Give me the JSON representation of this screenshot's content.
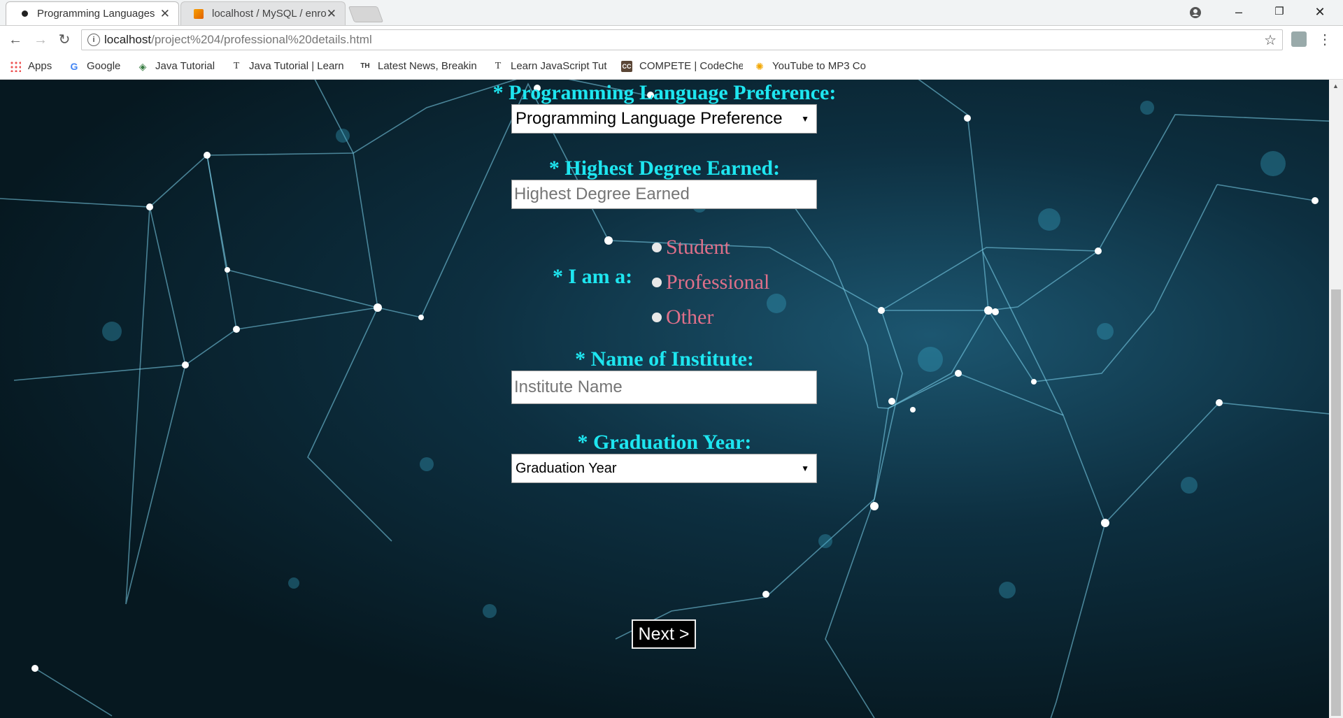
{
  "browser": {
    "tabs": [
      {
        "title": "Programming Languages",
        "active": true,
        "icon": "page-dot-icon"
      },
      {
        "title": "localhost / MySQL / enro",
        "active": false,
        "icon": "phpmyadmin-icon"
      }
    ],
    "url_host": "localhost",
    "url_path": "/project%204/professional%20details.html",
    "bookmarks": [
      {
        "label": "Apps",
        "icon": "apps-grid-icon"
      },
      {
        "label": "Google",
        "icon": "google-icon"
      },
      {
        "label": "Java Tutorial",
        "icon": "diamond-icon"
      },
      {
        "label": "Java Tutorial | Learn",
        "icon": "t-icon"
      },
      {
        "label": "Latest News, Breakin",
        "icon": "th-icon"
      },
      {
        "label": "Learn JavaScript Tut",
        "icon": "t-icon"
      },
      {
        "label": "COMPETE | CodeChe",
        "icon": "codechef-icon"
      },
      {
        "label": "YouTube to MP3 Co",
        "icon": "converter-icon"
      }
    ]
  },
  "form": {
    "language_label": "* Programming Language Preference:",
    "language_select": "Programming Language Preference",
    "degree_label": "* Highest Degree Earned:",
    "degree_placeholder": "Highest Degree Earned",
    "iam_label": "* I am a:",
    "options": [
      "Student",
      "Professional",
      "Other"
    ],
    "institute_label": "* Name of Institute:",
    "institute_placeholder": "Institute Name",
    "grad_label": "* Graduation Year:",
    "grad_select": "Graduation Year",
    "next_label": "Next >"
  },
  "colors": {
    "label": "#1ee6f0",
    "option": "#e0708a"
  }
}
